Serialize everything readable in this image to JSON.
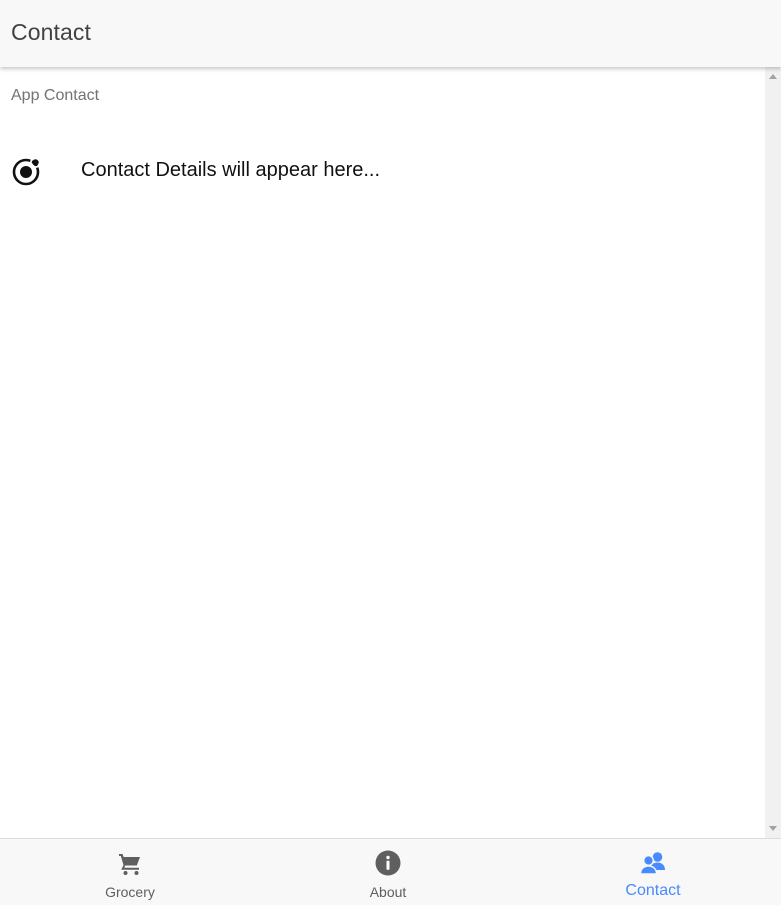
{
  "header": {
    "title": "Contact"
  },
  "content": {
    "list_header": "App Contact",
    "item": {
      "icon": "ionic-logo-icon",
      "label": "Contact Details will appear here..."
    }
  },
  "tabs": [
    {
      "label": "Grocery",
      "icon": "cart-icon",
      "active": false
    },
    {
      "label": "About",
      "icon": "info-icon",
      "active": false
    },
    {
      "label": "Contact",
      "icon": "people-icon",
      "active": true
    }
  ],
  "colors": {
    "active": "#488aff",
    "inactive": "#5f5f5f",
    "icon_inactive": "#5f5f5f"
  }
}
